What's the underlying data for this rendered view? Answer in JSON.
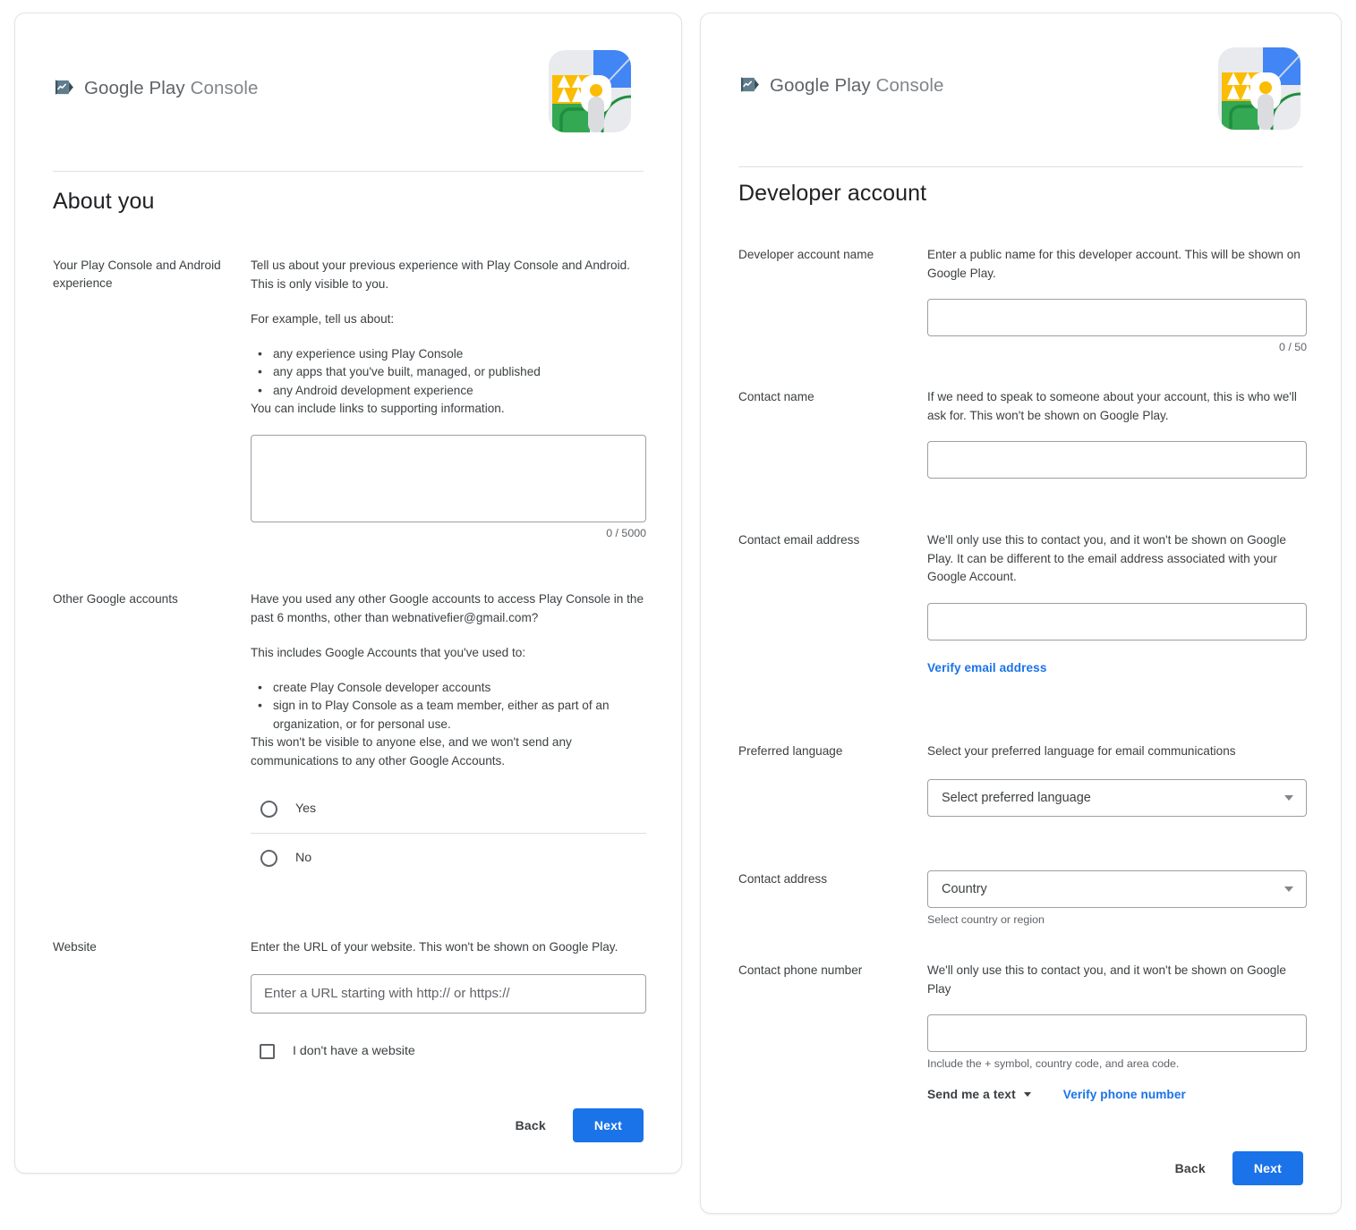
{
  "brand": {
    "name_primary": "Google Play",
    "name_secondary": "Console",
    "logo_icon": "google-play-console-logo",
    "avatar_icon": "account-avatar-illustration"
  },
  "colors": {
    "accent_blue": "#1a73e8",
    "text_primary": "#3c4043",
    "text_secondary": "#5f6368",
    "border": "#9aa0a6",
    "divider": "#e0e0e0"
  },
  "left_panel": {
    "title": "About you",
    "experience": {
      "label": "Your Play Console and Android experience",
      "desc1": "Tell us about your previous experience with Play Console and Android. This is only visible to you.",
      "desc2": "For example, tell us about:",
      "bullets": [
        "any experience using Play Console",
        "any apps that you've built, managed, or published",
        "any Android development experience"
      ],
      "desc3": "You can include links to supporting information.",
      "textarea_value": "",
      "counter": "0 / 5000"
    },
    "other_accounts": {
      "label": "Other Google accounts",
      "desc1": "Have you used any other Google accounts to access Play Console in the past 6 months, other than webnativefier@gmail.com?",
      "desc2": "This includes Google Accounts that you've used to:",
      "bullets": [
        "create Play Console developer accounts",
        "sign in to Play Console as a team member, either as part of an organization, or for personal use."
      ],
      "desc3": "This won't be visible to anyone else, and we won't send any communications to any other Google Accounts.",
      "option_yes": "Yes",
      "option_no": "No",
      "selected": ""
    },
    "website": {
      "label": "Website",
      "desc": "Enter the URL of your website. This won't be shown on Google Play.",
      "input_value": "",
      "input_placeholder": "Enter a URL starting with http:// or https://",
      "checkbox_label": "I don't have a website",
      "checkbox_checked": false
    },
    "actions": {
      "back_label": "Back",
      "next_label": "Next"
    }
  },
  "right_panel": {
    "title": "Developer account",
    "developer_account_name": {
      "label": "Developer account name",
      "desc": "Enter a public name for this developer account. This will be shown on Google Play.",
      "input_value": "",
      "counter": "0 / 50"
    },
    "contact_name": {
      "label": "Contact name",
      "desc": "If we need to speak to someone about your account, this is who we'll ask for. This won't be shown on Google Play.",
      "input_value": ""
    },
    "contact_email": {
      "label": "Contact email address",
      "desc": "We'll only use this to contact you, and it won't be shown on Google Play. It can be different to the email address associated with your Google Account.",
      "input_value": "",
      "verify_link": "Verify email address"
    },
    "preferred_language": {
      "label": "Preferred language",
      "desc": "Select your preferred language for email communications",
      "select_value": "Select preferred language"
    },
    "contact_address": {
      "label": "Contact address",
      "select_value": "Country",
      "helper": "Select country or region"
    },
    "contact_phone": {
      "label": "Contact phone number",
      "desc": "We'll only use this to contact you, and it won't be shown on Google Play",
      "input_value": "",
      "helper": "Include the + symbol, country code, and area code.",
      "method_value": "Send me a text",
      "verify_link": "Verify phone number"
    },
    "actions": {
      "back_label": "Back",
      "next_label": "Next"
    }
  }
}
